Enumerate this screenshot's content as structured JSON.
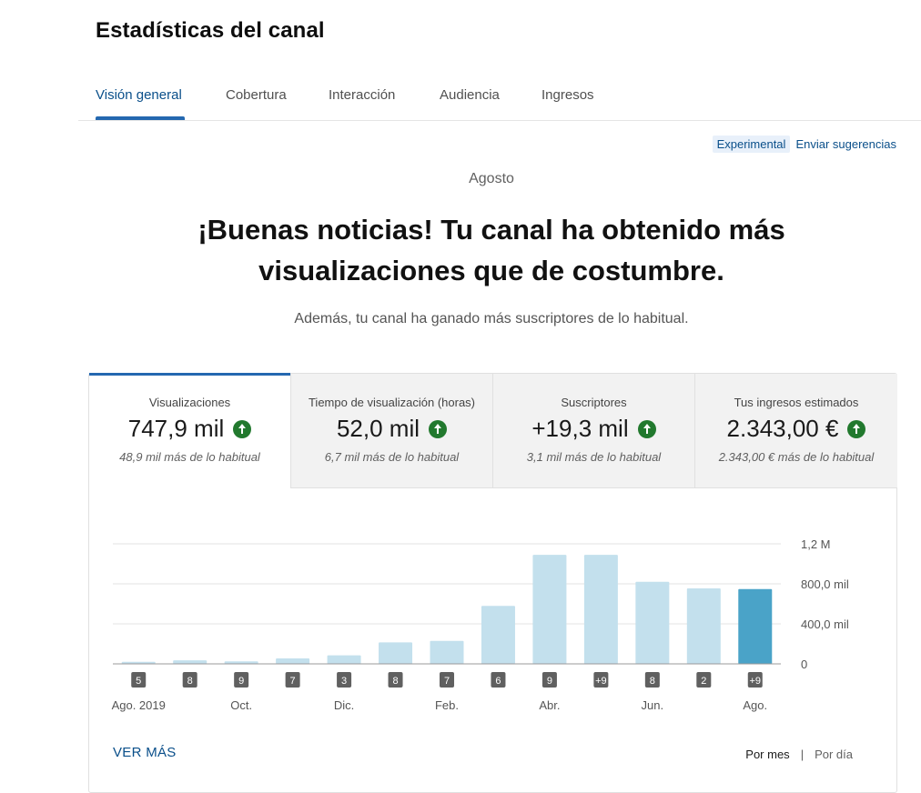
{
  "page": {
    "title": "Estadísticas del canal"
  },
  "tabs": [
    {
      "label": "Visión general",
      "active": true
    },
    {
      "label": "Cobertura",
      "active": false
    },
    {
      "label": "Interacción",
      "active": false
    },
    {
      "label": "Audiencia",
      "active": false
    },
    {
      "label": "Ingresos",
      "active": false
    }
  ],
  "links": {
    "experimental": "Experimental",
    "feedback": "Enviar sugerencias"
  },
  "summary": {
    "month": "Agosto",
    "headline": "¡Buenas noticias! Tu canal ha obtenido más visualizaciones que de costumbre.",
    "subline": "Además, tu canal ha ganado más suscriptores de lo habitual."
  },
  "metrics": [
    {
      "label": "Visualizaciones",
      "value": "747,9 mil",
      "note": "48,9 mil más de lo habitual",
      "trend": "up-arrow-icon",
      "active": true
    },
    {
      "label": "Tiempo de visualización (horas)",
      "value": "52,0 mil",
      "note": "6,7 mil más de lo habitual",
      "trend": "up-arrow-icon",
      "active": false
    },
    {
      "label": "Suscriptores",
      "value": "+19,3 mil",
      "note": "3,1 mil más de lo habitual",
      "trend": "up-arrow-icon",
      "active": false
    },
    {
      "label": "Tus ingresos estimados",
      "value": "2.343,00 €",
      "note": "2.343,00 € más de lo habitual",
      "trend": "up-arrow-icon",
      "active": false
    }
  ],
  "chart_data": {
    "type": "bar",
    "title": "",
    "xlabel": "",
    "ylabel": "",
    "ylim": [
      0,
      1200000
    ],
    "y_ticks": [
      {
        "value": 0,
        "label": "0"
      },
      {
        "value": 400000,
        "label": "400,0 mil"
      },
      {
        "value": 800000,
        "label": "800,0 mil"
      },
      {
        "value": 1200000,
        "label": "1,2 M"
      }
    ],
    "x_tick_labels": [
      "Ago. 2019",
      "",
      "Oct.",
      "",
      "Dic.",
      "",
      "Feb.",
      "",
      "Abr.",
      "",
      "Jun.",
      "",
      "Ago."
    ],
    "values": [
      20000,
      35000,
      25000,
      55000,
      85000,
      215000,
      230000,
      580000,
      1090000,
      1090000,
      820000,
      755000,
      747900
    ],
    "video_counts": [
      "5",
      "8",
      "9",
      "7",
      "3",
      "8",
      "7",
      "6",
      "9",
      "+9",
      "8",
      "2",
      "+9"
    ],
    "highlight_index": 12,
    "grid": true,
    "colors": {
      "bar": "#c3e0ed",
      "highlight": "#4aa3c8",
      "grid": "#e3e3e3",
      "axis": "#999999",
      "badge": "#606060"
    }
  },
  "footer": {
    "see_more": "VER MÁS",
    "per_month": "Por mes",
    "separator": "|",
    "per_day": "Por día"
  }
}
